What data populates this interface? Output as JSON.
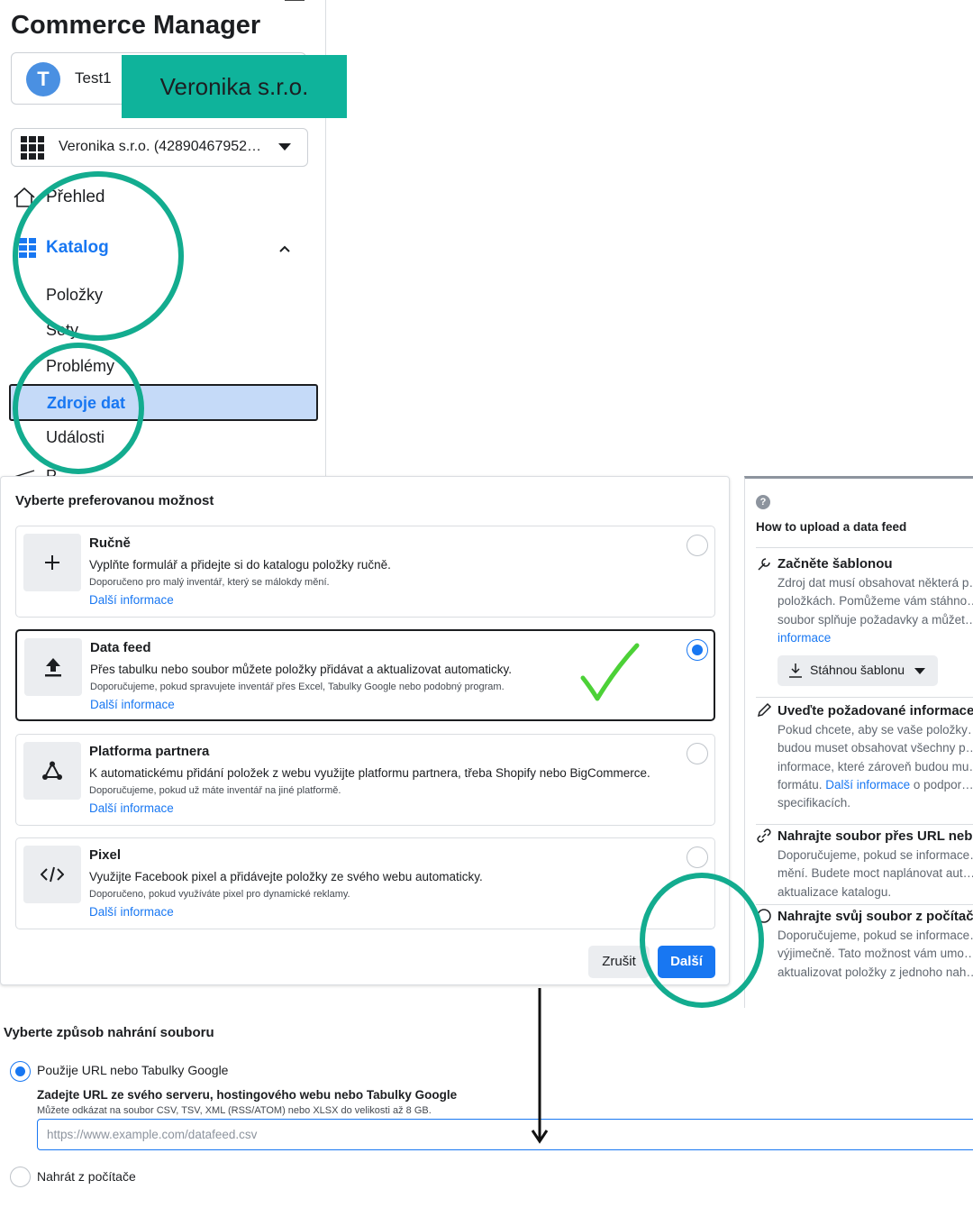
{
  "app": {
    "title": "Commerce Manager"
  },
  "account": {
    "avatar_letter": "T",
    "name": "Test1"
  },
  "banner": {
    "text": "Veronika s.r.o."
  },
  "business": {
    "selected": "Veronika s.r.o. (42890467952…"
  },
  "sidebar": {
    "overview": "Přehled",
    "catalog": "Katalog",
    "items": "Položky",
    "sets": "Sety",
    "problems": "Problémy",
    "data_sources": "Zdroje dat",
    "events": "Události",
    "next_item": "P…"
  },
  "dialog": {
    "title": "Vyberte preferovanou možnost",
    "options": [
      {
        "icon": "+",
        "title": "Ručně",
        "description": "Vyplňte formulář a přidejte si do katalogu položky ručně.",
        "note": "Doporučeno pro malý inventář, který se málokdy mění.",
        "link": "Další informace",
        "selected": false
      },
      {
        "icon": "upload-icon",
        "title": "Data feed",
        "description": "Přes tabulku nebo soubor můžete položky přidávat a aktualizovat automaticky.",
        "note": "Doporučujeme, pokud spravujete inventář přes Excel, Tabulky Google nebo podobný program.",
        "link": "Další informace",
        "selected": true
      },
      {
        "icon": "partner-icon",
        "title": "Platforma partnera",
        "description": "K automatickému přidání položek z webu využijte platformu partnera, třeba Shopify nebo BigCommerce.",
        "note": "Doporučujeme, pokud už máte inventář na jiné platformě.",
        "link": "Další informace",
        "selected": false
      },
      {
        "icon": "</>",
        "title": "Pixel",
        "description": "Využijte Facebook pixel a přidávejte položky ze svého webu automaticky.",
        "note": "Doporučeno, pokud využíváte pixel pro dynamické reklamy.",
        "link": "Další informace",
        "selected": false
      }
    ],
    "cancel": "Zrušit",
    "next": "Další"
  },
  "help": {
    "title": "How to upload a data feed",
    "sections": [
      {
        "heading": "Začněte šablonou",
        "text": "Zdroj dat musí obsahovat některá p… položkách. Pomůžeme vám stáhno… soubor splňuje požadavky a můžet…",
        "link": "informace"
      },
      {
        "heading": "Uveďte požadované informace",
        "text": "Pokud chcete, aby se vaše položky… budou muset obsahovat všechny p… informace, které zároveň budou mu… formátu.",
        "link": "Další informace",
        "text_after": "o podpor… specifikacích."
      },
      {
        "heading": "Nahrajte soubor přes URL neb…",
        "text": "Doporučujeme, pokud se informace… mění. Budete moct naplánovat aut… aktualizace katalogu."
      },
      {
        "heading": "Nahrajte svůj soubor z počítač…",
        "text": "Doporučujeme, pokud se informace… výjimečně. Tato možnost vám umo… aktualizovat položky z jednoho nah…"
      }
    ],
    "template_button": "Stáhnou šablonu"
  },
  "upload": {
    "title": "Vyberte způsob nahrání souboru",
    "option_url": "Použije URL nebo Tabulky Google",
    "url_heading": "Zadejte URL ze svého serveru, hostingového webu nebo Tabulky Google",
    "url_help": "Můžete odkázat na soubor CSV, TSV, XML (RSS/ATOM) nebo XLSX do velikosti až 8 GB.",
    "url_placeholder": "https://www.example.com/datafeed.csv",
    "option_pc": "Nahrát z počítače"
  },
  "colors": {
    "accent": "#1877f2",
    "annotation_teal": "#13ac8f",
    "banner_teal": "#0fb39b",
    "checkmark_green": "#4cd137",
    "selected_bg": "#c5daf8"
  }
}
